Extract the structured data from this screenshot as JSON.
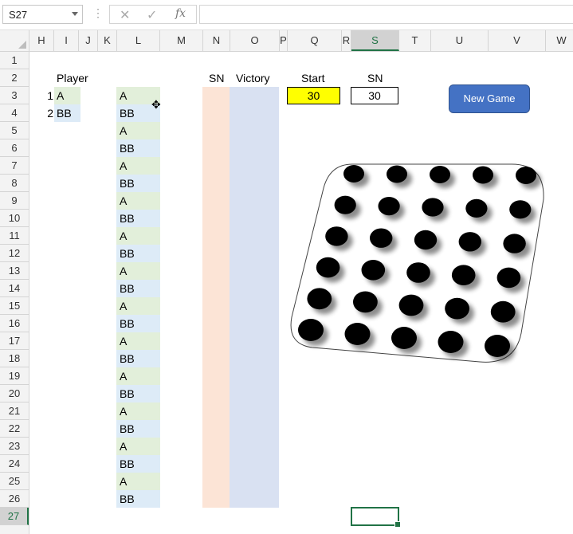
{
  "formula_bar": {
    "name_box": "S27",
    "cancel_icon": "✕",
    "enter_icon": "✓",
    "fx_label": "fx",
    "formula": ""
  },
  "columns": [
    "H",
    "I",
    "J",
    "K",
    "L",
    "M",
    "N",
    "O",
    "P",
    "Q",
    "R",
    "S",
    "T",
    "U",
    "V",
    "W"
  ],
  "selected_column": "S",
  "rows": [
    "1",
    "2",
    "3",
    "4",
    "5",
    "6",
    "7",
    "8",
    "9",
    "10",
    "11",
    "12",
    "13",
    "14",
    "15",
    "16",
    "17",
    "18",
    "19",
    "20",
    "21",
    "22",
    "23",
    "24",
    "25",
    "26",
    "27"
  ],
  "selected_row": "27",
  "headers": {
    "player": "Player",
    "sn_left": "SN",
    "victory": "Victory",
    "start": "Start",
    "sn_right": "SN"
  },
  "players": [
    {
      "num": "1",
      "name": "A"
    },
    {
      "num": "2",
      "name": "BB"
    }
  ],
  "turns": [
    "A",
    "BB",
    "A",
    "BB",
    "A",
    "BB",
    "A",
    "BB",
    "A",
    "BB",
    "A",
    "BB",
    "A",
    "BB",
    "A",
    "BB",
    "A",
    "BB",
    "A",
    "BB",
    "A",
    "BB",
    "A",
    "BB"
  ],
  "start_value": "30",
  "sn_value": "30",
  "new_game_label": "New Game",
  "board": {
    "rows": 6,
    "cols": 5,
    "peg_color": "#000000"
  },
  "colors": {
    "player_a": "#e2efda",
    "player_b": "#ddebf7",
    "sn_fill": "#fce4d6",
    "victory_fill": "#d9e1f2",
    "start_fill": "#ffff00",
    "button": "#4472c4",
    "selection": "#217346"
  }
}
